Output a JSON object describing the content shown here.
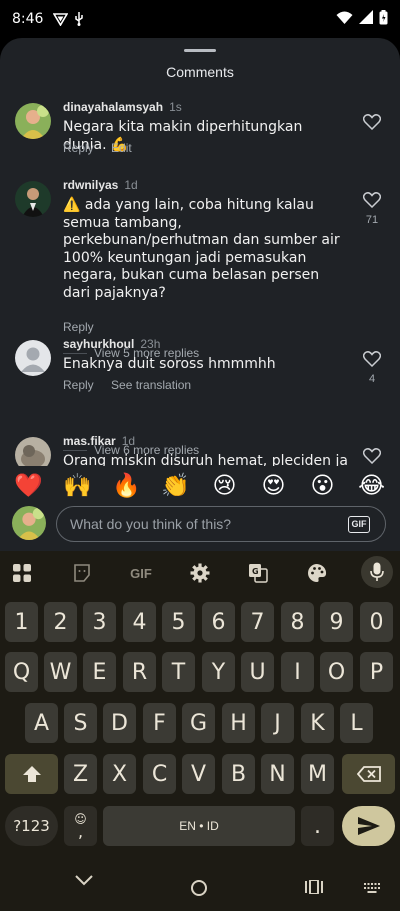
{
  "status_bar": {
    "time": "8:46"
  },
  "sheet": {
    "title": "Comments"
  },
  "comments": [
    {
      "user": "dinayahalamsyah",
      "time": "1s",
      "text": "Negara kita makin diperhitungkan dunia. 💪",
      "actions": [
        "Reply",
        "Edit"
      ],
      "likes": ""
    },
    {
      "user": "rdwnilyas",
      "time": "1d",
      "text": "⚠️ ada yang lain, coba hitung kalau semua tambang, perkebunan/perhutman dan sumber air 100% keuntungan jadi pemasukan negara, bukan cuma belasan persen dari pajaknya?",
      "actions": [
        "Reply"
      ],
      "likes": "71",
      "view_more": "View 5 more replies"
    },
    {
      "user": "sayhurkhoul",
      "time": "23h",
      "text": "Enaknya duit soross hmmmhh",
      "actions": [
        "Reply",
        "See translation"
      ],
      "likes": "4",
      "view_more": "View 6 more replies"
    },
    {
      "user": "mas.fikar",
      "time": "1d",
      "text": "Orang miskin disuruh hemat, pleciden jalan",
      "likes": ""
    }
  ],
  "emojis": [
    "❤️",
    "🙌",
    "🔥",
    "👏",
    "😢",
    "😍",
    "😮",
    "😂"
  ],
  "input": {
    "placeholder": "What do you think of this?",
    "gif_label": "GIF"
  },
  "keyboard": {
    "toolbar": {
      "gif_label": "GIF"
    },
    "row_numbers": [
      "1",
      "2",
      "3",
      "4",
      "5",
      "6",
      "7",
      "8",
      "9",
      "0"
    ],
    "row_1": [
      "Q",
      "W",
      "E",
      "R",
      "T",
      "Y",
      "U",
      "I",
      "O",
      "P"
    ],
    "row_2": [
      "A",
      "S",
      "D",
      "F",
      "G",
      "H",
      "J",
      "K",
      "L"
    ],
    "row_3": [
      "Z",
      "X",
      "C",
      "V",
      "B",
      "N",
      "M"
    ],
    "symbols_label": "?123",
    "emoji_key": "☺",
    "comma": ",",
    "space_label": "EN • ID",
    "period": "."
  },
  "colors": {
    "sheet_bg": "#1f2226",
    "keyboard_bg": "#1d1b14",
    "key_bg": "#3b3a34",
    "enter_bg": "#cfc79e"
  }
}
